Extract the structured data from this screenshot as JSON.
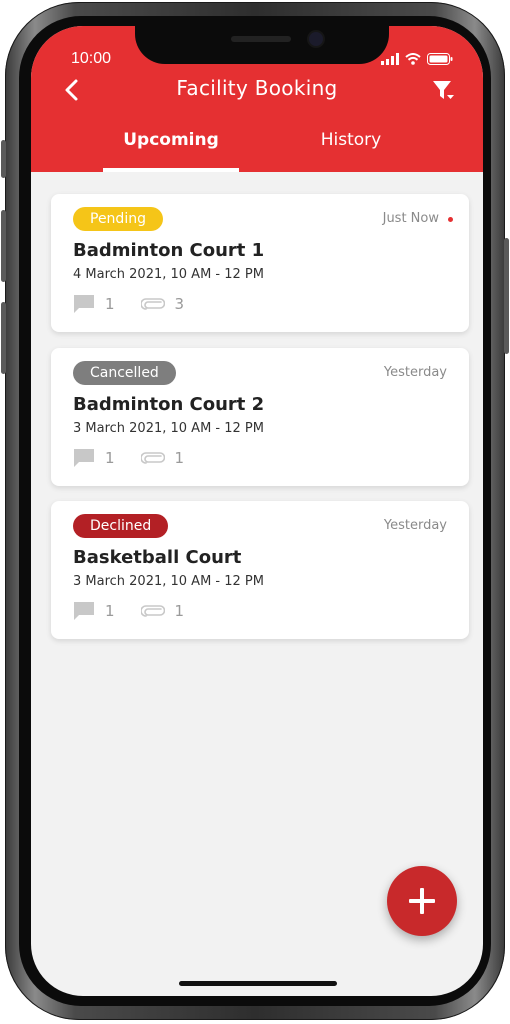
{
  "status_bar": {
    "time": "10:00"
  },
  "header": {
    "title": "Facility Booking",
    "back_icon": "chevron-left-icon",
    "filter_icon": "filter-icon",
    "color": "#e53032"
  },
  "tabs": [
    {
      "label": "Upcoming",
      "active": true
    },
    {
      "label": "History",
      "active": false
    }
  ],
  "bookings": [
    {
      "status": "Pending",
      "status_color": "#f5c518",
      "when": "Just Now",
      "unread": true,
      "title": "Badminton Court 1",
      "date": "4 March 2021, 10 AM - 12 PM",
      "comments": "1",
      "attachments": "3"
    },
    {
      "status": "Cancelled",
      "status_color": "#7e7e7e",
      "when": "Yesterday",
      "unread": false,
      "title": "Badminton Court 2",
      "date": "3 March 2021, 10 AM - 12 PM",
      "comments": "1",
      "attachments": "1"
    },
    {
      "status": "Declined",
      "status_color": "#b32025",
      "when": "Yesterday",
      "unread": false,
      "title": "Basketball Court",
      "date": "3 March 2021, 10 AM - 12 PM",
      "comments": "1",
      "attachments": "1"
    }
  ],
  "fab": {
    "icon": "plus-icon",
    "color": "#c8292b"
  }
}
